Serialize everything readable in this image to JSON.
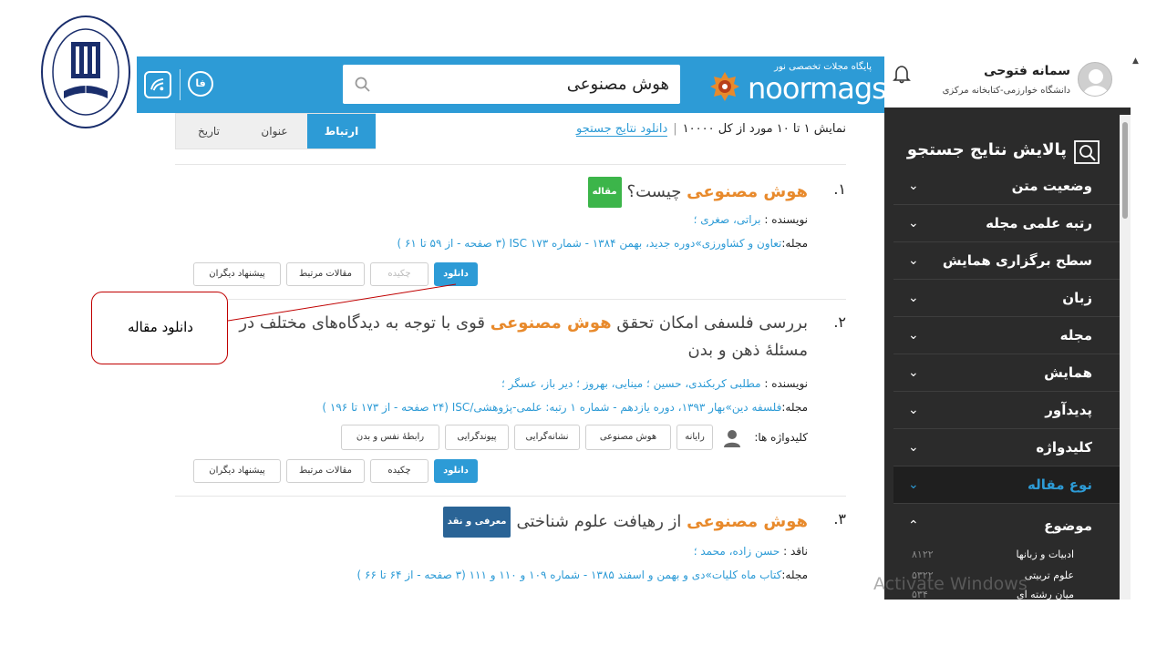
{
  "header": {
    "search_value": "هوش مصنوعی",
    "lang_label": "فا",
    "brand_subtitle": "پایگاه مجلات تخصصی نور",
    "brand_name": "noormags"
  },
  "user": {
    "name": "سمانه فتوحی",
    "org": "دانشگاه خوارزمی-کتابخانه مرکزی"
  },
  "sidebar": {
    "title": "پالایش نتایج جستجو",
    "filters": [
      {
        "label": "وضعیت متن",
        "chevron": "⌄"
      },
      {
        "label": "رتبه علمی مجله",
        "chevron": "⌄"
      },
      {
        "label": "سطح برگزاری همایش",
        "chevron": "⌄"
      },
      {
        "label": "زبان",
        "chevron": "⌄"
      },
      {
        "label": "مجله",
        "chevron": "⌄"
      },
      {
        "label": "همایش",
        "chevron": "⌄"
      },
      {
        "label": "پدیدآور",
        "chevron": "⌄"
      },
      {
        "label": "کلیدواژه",
        "chevron": "⌄"
      },
      {
        "label": "نوع مقاله",
        "chevron": "⌄"
      },
      {
        "label": "موضوع",
        "chevron": "⌃"
      }
    ],
    "subjects": [
      {
        "label": "ادبیات و زبانها",
        "count": "۸۱۲۲"
      },
      {
        "label": "علوم تربیتی",
        "count": "۵۳۲۲"
      },
      {
        "label": "میان رشته ای",
        "count": "۵۳۴"
      }
    ]
  },
  "results_header": {
    "count_text": "نمایش ۱ تا ۱۰ مورد از کل ۱۰۰۰۰",
    "download_link": "دانلود نتایج جستجو",
    "tabs": [
      "ارتباط",
      "عنوان",
      "تاریخ"
    ]
  },
  "results": [
    {
      "num": "۱.",
      "title_hl": "هوش مصنوعی",
      "title_rest": " چیست؟",
      "badge": "مقاله",
      "author_label": "نویسنده : ",
      "authors": "براتی، صغری ؛",
      "journal_label": "مجله:",
      "journal": "تعاون و کشاورزی»دوره جدید، بهمن ۱۳۸۴ - شماره ۱۷۳ ISC (۳ صفحه - از ۵۹ تا ۶۱ )",
      "buttons": [
        "دانلود",
        "چکیده",
        "مقالات مرتبط",
        "پیشنهاد دیگران"
      ]
    },
    {
      "num": "۲.",
      "title_line1_pre": "بررسی فلسفی امکان تحقق ",
      "title_hl": "هوش مصنوعی",
      "title_line1_post": " قوی با توجه به دیدگاه‌های مختلف در",
      "title_line2": "مسئلۀ ذهن و بدن",
      "author_label": "نویسنده : ",
      "authors": "مطلبی کربکندی، حسین ؛ مینایی، بهروز ؛ دیر باز، عسگر ؛",
      "journal_label": "مجله:",
      "journal": "فلسفه دین»بهار ۱۳۹۳، دوره یازدهم - شماره ۱ رتبه: علمی-پژوهشی/ISC (۲۴ صفحه - از ۱۷۳ تا ۱۹۶ )",
      "keywords_label": "کلیدواژه ها:",
      "keywords": [
        "رایانه",
        "هوش مصنوعی",
        "نشانه‌گرایی",
        "پیوندگرایی",
        "رابطۀ نفس و بدن"
      ],
      "buttons": [
        "دانلود",
        "چکیده",
        "مقالات مرتبط",
        "پیشنهاد دیگران"
      ]
    },
    {
      "num": "۳.",
      "title_hl": "هوش مصنوعی",
      "title_rest": " از رهیافت علوم شناختی",
      "badge": "معرفی و نقد",
      "author_label": "ناقد : ",
      "authors": "حسن زاده، محمد ؛",
      "journal_label": "مجله:",
      "journal": "کتاب ماه کلیات»دی و بهمن و اسفند ۱۳۸۵ - شماره ۱۰۹ و ۱۱۰ و ۱۱۱ (۳ صفحه - از ۶۴ تا ۶۶ )"
    }
  ],
  "callout": {
    "text": "دانلود مقاله"
  },
  "watermark": "Activate Windows",
  "colors": {
    "accent": "#2d9bd6",
    "highlight": "#e88a2c",
    "sidebar_bg": "#2b2b2b",
    "callout_border": "#c00000"
  }
}
